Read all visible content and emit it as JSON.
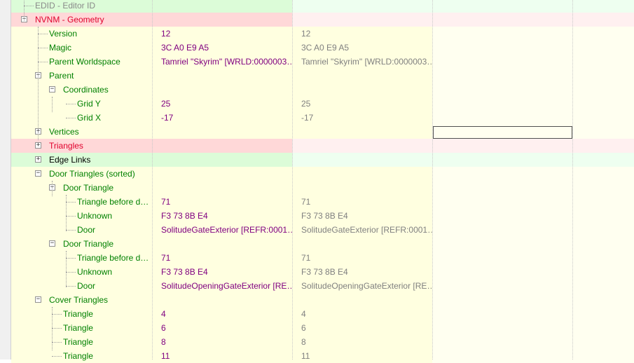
{
  "colors": {
    "name_green": "#008000",
    "name_red": "#e0002c",
    "value_purple": "#800080",
    "value_gray": "#808080",
    "row_green": "#dcfcd8",
    "row_red": "#ffd8d8",
    "row_yellow": "#ffffe0",
    "row_light_green": "#eefff0",
    "row_light_red": "#fff0f0"
  },
  "rows": [
    {
      "label": "EDID - Editor ID",
      "color": "gray",
      "bg": "green"
    },
    {
      "label": "NVNM - Geometry",
      "color": "red",
      "bg": "red",
      "expander": "minus"
    },
    {
      "label": "Version",
      "color": "green",
      "bg": "yellow",
      "value1": "12",
      "value2": "12"
    },
    {
      "label": "Magic",
      "color": "green",
      "bg": "yellow",
      "value1": "3C A0 E9 A5",
      "value2": "3C A0 E9 A5"
    },
    {
      "label": "Parent Worldspace",
      "color": "green",
      "bg": "yellow",
      "value1": "Tamriel \"Skyrim\" [WRLD:0000003…",
      "value2": "Tamriel \"Skyrim\" [WRLD:0000003…"
    },
    {
      "label": "Parent",
      "color": "green",
      "bg": "yellow",
      "expander": "minus"
    },
    {
      "label": "Coordinates",
      "color": "green",
      "bg": "yellow",
      "expander": "minus"
    },
    {
      "label": "Grid Y",
      "color": "green",
      "bg": "yellow",
      "value1": "25",
      "value2": "25"
    },
    {
      "label": "Grid X",
      "color": "green",
      "bg": "yellow",
      "value1": "-17",
      "value2": "-17"
    },
    {
      "label": "Vertices",
      "color": "green",
      "bg": "yellow",
      "expander": "plus"
    },
    {
      "label": "Triangles",
      "color": "red",
      "bg": "red",
      "expander": "plus"
    },
    {
      "label": "Edge Links",
      "color": "black",
      "bg": "green",
      "expander": "plus"
    },
    {
      "label": "Door Triangles (sorted)",
      "color": "green",
      "bg": "yellow",
      "expander": "minus"
    },
    {
      "label": "Door Triangle",
      "color": "green",
      "bg": "yellow",
      "expander": "minus"
    },
    {
      "label": "Triangle before d…",
      "color": "green",
      "bg": "yellow",
      "value1": "71",
      "value2": "71"
    },
    {
      "label": "Unknown",
      "color": "green",
      "bg": "yellow",
      "value1": "F3 73 8B E4",
      "value2": "F3 73 8B E4"
    },
    {
      "label": "Door",
      "color": "green",
      "bg": "yellow",
      "value1": "SolitudeGateExterior [REFR:0001…",
      "value2": "SolitudeGateExterior [REFR:0001…"
    },
    {
      "label": "Door Triangle",
      "color": "green",
      "bg": "yellow",
      "expander": "minus"
    },
    {
      "label": "Triangle before d…",
      "color": "green",
      "bg": "yellow",
      "value1": "71",
      "value2": "71"
    },
    {
      "label": "Unknown",
      "color": "green",
      "bg": "yellow",
      "value1": "F3 73 8B E4",
      "value2": "F3 73 8B E4"
    },
    {
      "label": "Door",
      "color": "green",
      "bg": "yellow",
      "value1": "SolitudeOpeningGateExterior [RE…",
      "value2": "SolitudeOpeningGateExterior [RE…"
    },
    {
      "label": "Cover Triangles",
      "color": "green",
      "bg": "yellow",
      "expander": "minus"
    },
    {
      "label": "Triangle",
      "color": "green",
      "bg": "yellow",
      "value1": "4",
      "value2": "4"
    },
    {
      "label": "Triangle",
      "color": "green",
      "bg": "yellow",
      "value1": "6",
      "value2": "6"
    },
    {
      "label": "Triangle",
      "color": "green",
      "bg": "yellow",
      "value1": "8",
      "value2": "8"
    },
    {
      "label": "Triangle",
      "color": "green",
      "bg": "yellow",
      "value1": "11",
      "value2": "11"
    }
  ]
}
